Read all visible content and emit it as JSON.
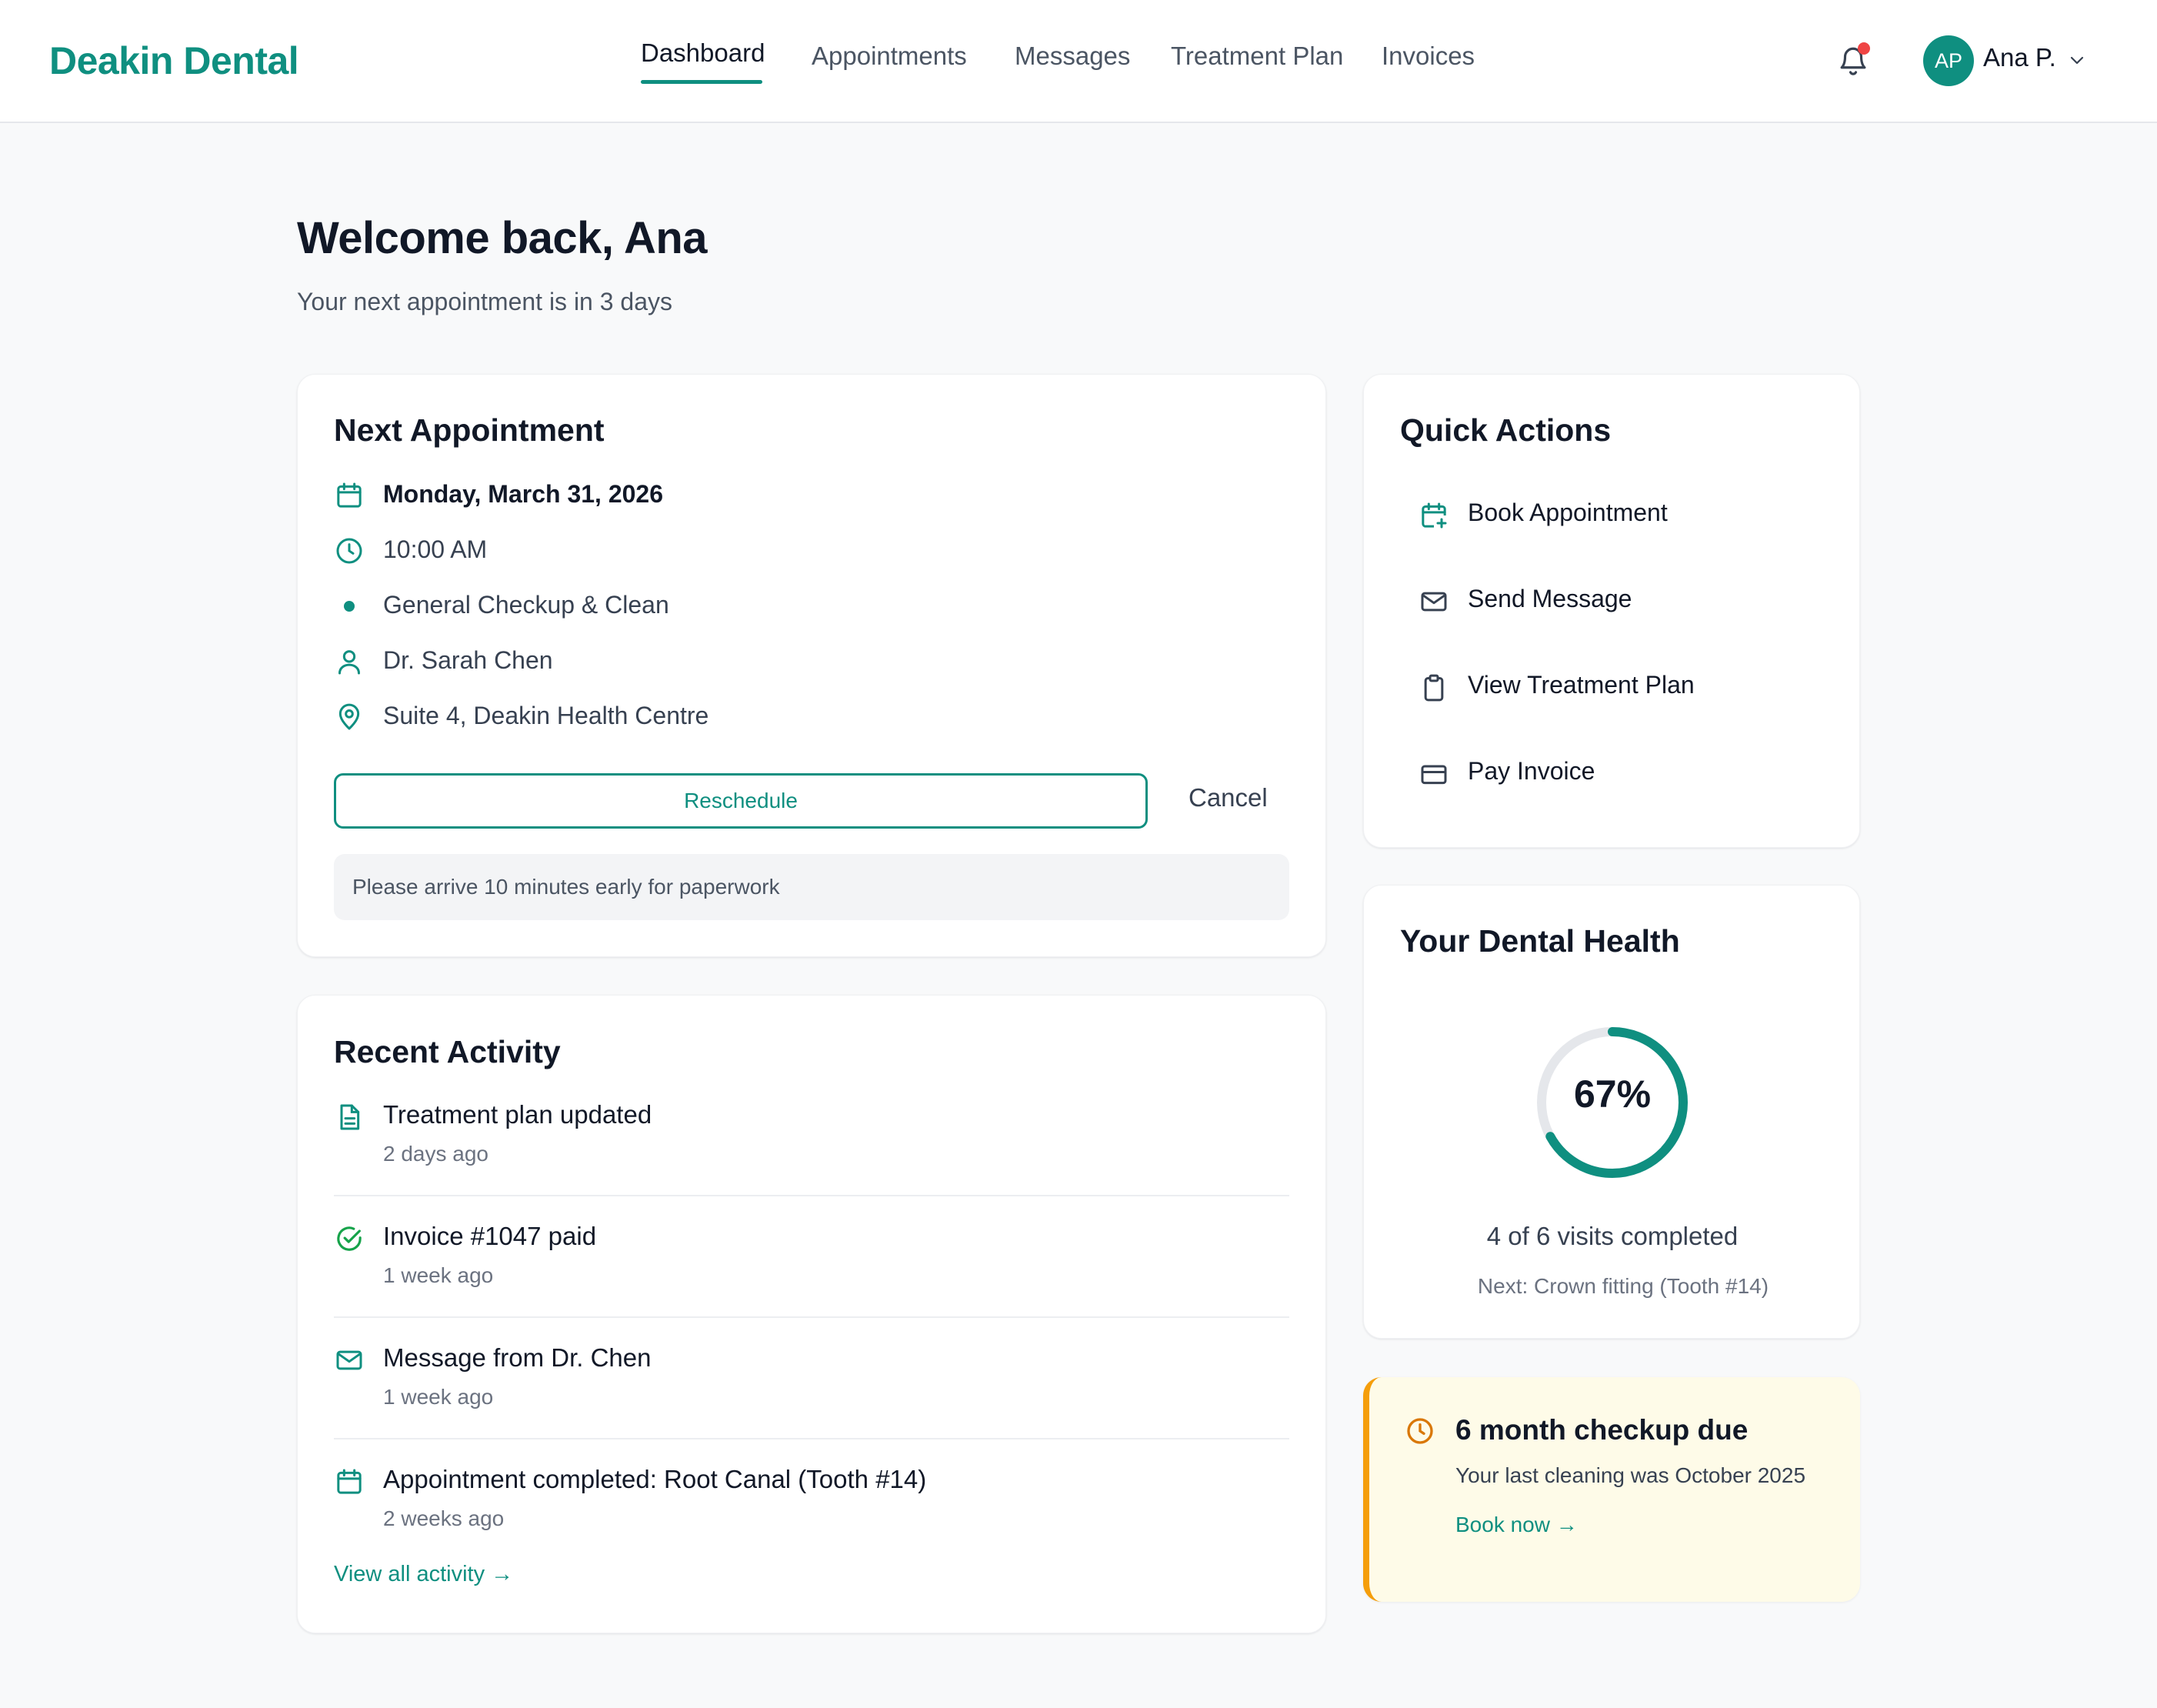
{
  "header": {
    "brand": "Deakin Dental",
    "nav": [
      "Dashboard",
      "Appointments",
      "Messages",
      "Treatment Plan",
      "Invoices"
    ],
    "active_nav": "Dashboard",
    "user_initials": "AP",
    "user_name": "Ana P.",
    "notification_icon": "bell-icon",
    "has_unread_notification": true
  },
  "page": {
    "title": "Welcome back, Ana",
    "subtitle": "Your next appointment is in 3 days"
  },
  "next_appointment": {
    "title": "Next Appointment",
    "date": "Monday, March 31, 2026",
    "time": "10:00 AM",
    "service": "General Checkup & Clean",
    "dentist": "Dr. Sarah Chen",
    "location": "Suite 4, Deakin Health Centre",
    "reschedule_label": "Reschedule",
    "cancel_label": "Cancel",
    "note": "Please arrive 10 minutes early for paperwork"
  },
  "recent_activity": {
    "title": "Recent Activity",
    "items": [
      {
        "icon": "document-icon",
        "title": "Treatment plan updated",
        "time": "2 days ago"
      },
      {
        "icon": "check-circle-icon",
        "title": "Invoice #1047 paid",
        "time": "1 week ago"
      },
      {
        "icon": "mail-icon",
        "title": "Message from Dr. Chen",
        "time": "1 week ago"
      },
      {
        "icon": "calendar-icon",
        "title": "Appointment completed: Root Canal (Tooth #14)",
        "time": "2 weeks ago"
      }
    ],
    "view_all_label": "View all activity →"
  },
  "quick_actions": {
    "title": "Quick Actions",
    "items": [
      {
        "icon": "calendar-plus-icon",
        "label": "Book Appointment"
      },
      {
        "icon": "mail-icon",
        "label": "Send Message"
      },
      {
        "icon": "clipboard-icon",
        "label": "View Treatment Plan"
      },
      {
        "icon": "credit-card-icon",
        "label": "Pay Invoice"
      }
    ]
  },
  "dental_health": {
    "title": "Your Dental Health",
    "progress_percent": 67,
    "progress_label": "67%",
    "visits_text": "4 of 6 visits completed",
    "next_text": "Next: Crown fitting (Tooth #14)"
  },
  "checkup_alert": {
    "title": "6 month checkup due",
    "subtitle": "Your last cleaning was October 2025",
    "link_label": "Book now →"
  },
  "colors": {
    "accent": "#0f8f80",
    "warning": "#f59e0b",
    "alert_bg": "#fefbe8",
    "notification_dot": "#ef4444"
  }
}
